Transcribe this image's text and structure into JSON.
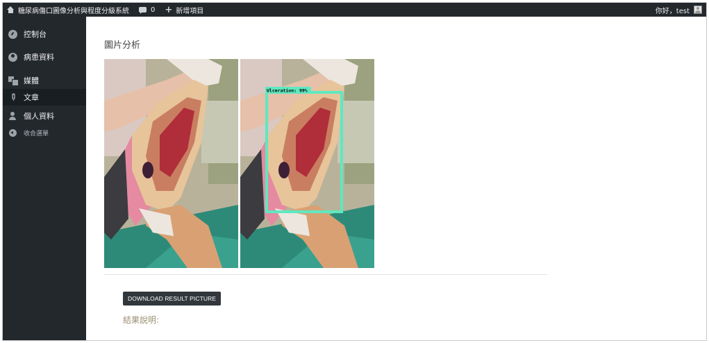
{
  "adminbar": {
    "site_title": "糖尿病傷口圖像分析與程度分級系統",
    "comment_count": "0",
    "new_item_label": "新增項目",
    "greeting": "你好，test"
  },
  "sidebar": {
    "items": [
      {
        "label": "控制台",
        "icon": "dashboard-icon"
      },
      {
        "label": "病患資料",
        "icon": "patient-icon"
      },
      {
        "label": "媒體",
        "icon": "media-icon"
      },
      {
        "label": "文章",
        "icon": "pin-icon"
      },
      {
        "label": "個人資料",
        "icon": "user-icon"
      },
      {
        "label": "收合選單",
        "icon": "collapse-icon"
      }
    ],
    "active_index": 3
  },
  "main": {
    "title": "圖片分析",
    "detection": {
      "label": "Ulceration: 99%",
      "box_color": "#5fe8c0"
    },
    "download_button": "DOWNLOAD RESULT PICTURE",
    "result_heading": "結果說明:"
  },
  "colors": {
    "adminbar_bg": "#23282d",
    "sidebar_bg": "#23282d",
    "sidebar_active_bg": "#191e23",
    "button_bg": "#32373c"
  }
}
